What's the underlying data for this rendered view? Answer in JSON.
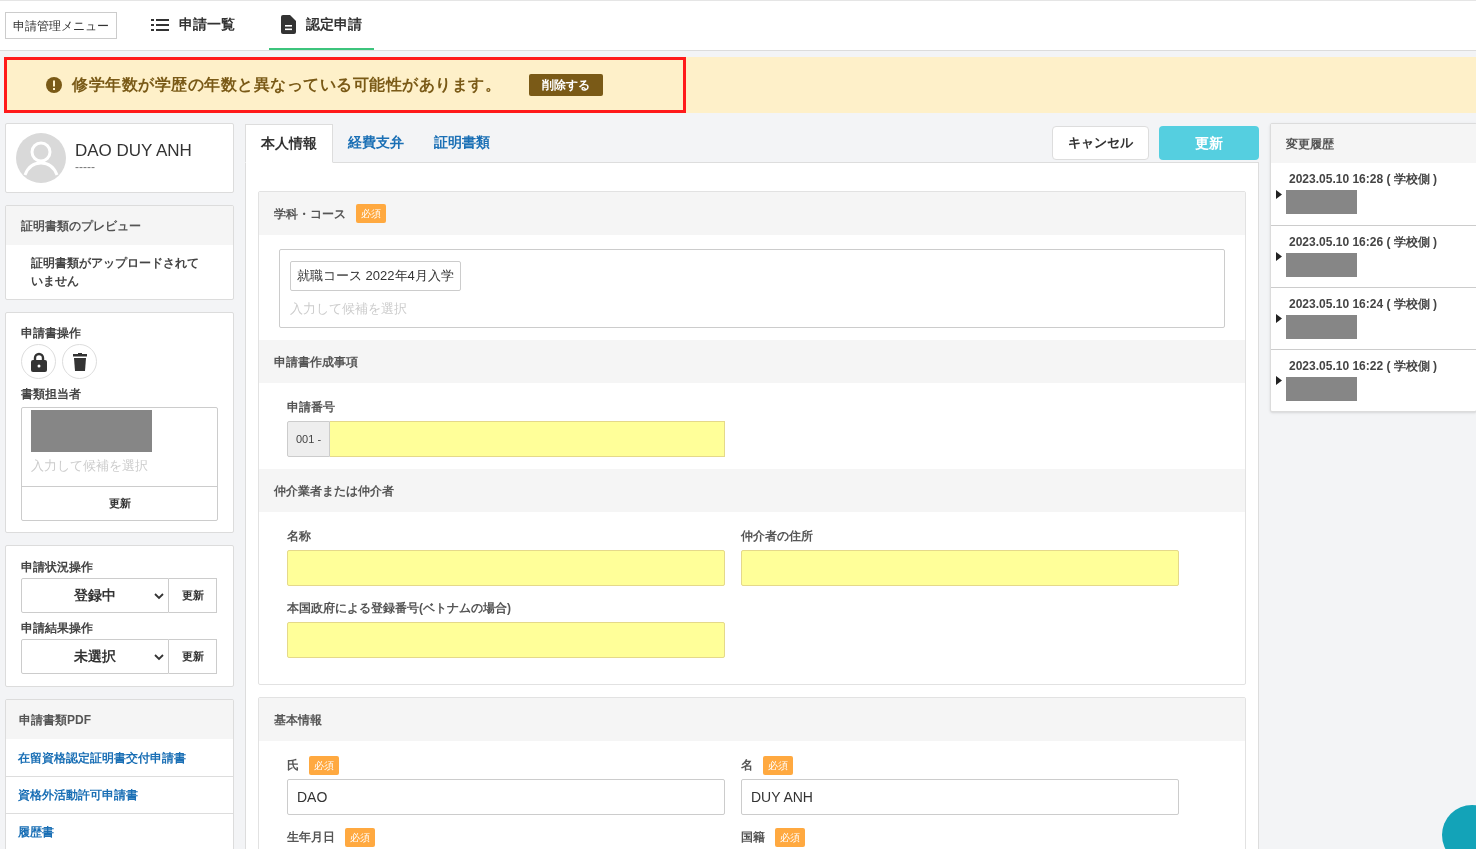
{
  "nav": {
    "menu_button": "申請管理メニュー",
    "tabs": [
      {
        "label": "申請一覧",
        "kind": "list",
        "selected": false
      },
      {
        "label": "認定申請",
        "kind": "document",
        "selected": true
      }
    ]
  },
  "alert": {
    "message": "修学年数が学歴の年数と異なっている可能性があります。",
    "button": "削除する",
    "framed": true
  },
  "profile": {
    "name": "DAO DUY ANH",
    "subtitle": "-----"
  },
  "preview": {
    "title": "証明書類のプレビュー",
    "message": "証明書類がアップロードされていません"
  },
  "operations": {
    "title": "申請書操作",
    "actions": [
      {
        "kind": "lock"
      },
      {
        "kind": "trash"
      }
    ],
    "assignee_label": "書類担当者",
    "assignee_placeholder": "入力して候補を選択",
    "assignee_button": "更新"
  },
  "status_controls": [
    {
      "label": "申請状況操作",
      "value": "登録中",
      "button": "更新"
    },
    {
      "label": "申請結果操作",
      "value": "未選択",
      "button": "更新"
    }
  ],
  "pdf": {
    "title": "申請書類PDF",
    "links": [
      "在留資格認定証明書交付申請書",
      "資格外活動許可申請書",
      "履歴書"
    ]
  },
  "tabs": [
    {
      "label": "本人情報",
      "selected": true
    },
    {
      "label": "経費支弁",
      "selected": false
    },
    {
      "label": "証明書類",
      "selected": false
    }
  ],
  "buttons": {
    "cancel": "キャンセル",
    "update": "更新"
  },
  "cards": [
    {
      "sections": [
        {
          "title": "学科・コース",
          "required": true,
          "required_label": "必須",
          "fields": [
            {
              "kind": "tags",
              "tags": [
                "就職コース 2022年4月入学"
              ],
              "placeholder": "入力して候補を選択"
            }
          ]
        },
        {
          "title": "申請書作成事項",
          "required": false,
          "fields": [
            {
              "kind": "prefixed",
              "label": "申請番号",
              "prefix": "001 -",
              "highlighted": true
            }
          ]
        },
        {
          "title": "仲介業者または仲介者",
          "required": false,
          "fields": [
            {
              "kind": "text",
              "label": "名称",
              "highlighted": true
            },
            {
              "kind": "text",
              "label": "仲介者の住所",
              "highlighted": true
            },
            {
              "kind": "text",
              "label": "本国政府による登録番号(ベトナムの場合)",
              "highlighted": true
            }
          ]
        }
      ]
    },
    {
      "sections": [
        {
          "title": "基本情報",
          "required": false,
          "fields": [
            {
              "kind": "text",
              "label": "氏",
              "required": true,
              "required_label": "必須",
              "value": "DAO",
              "highlighted": false
            },
            {
              "kind": "text",
              "label": "名",
              "required": true,
              "required_label": "必須",
              "value": "DUY ANH",
              "highlighted": false
            },
            {
              "kind": "text",
              "label": "生年月日",
              "required": true,
              "required_label": "必須"
            },
            {
              "kind": "text",
              "label": "国籍",
              "required": true,
              "required_label": "必須"
            }
          ]
        }
      ]
    }
  ],
  "history": {
    "title": "変更履歴",
    "items": [
      {
        "time": "2023.05.10 16:28 ( 学校側 )"
      },
      {
        "time": "2023.05.10 16:26 ( 学校側 )"
      },
      {
        "time": "2023.05.10 16:24 ( 学校側 )"
      },
      {
        "time": "2023.05.10 16:22 ( 学校側 )"
      }
    ]
  }
}
